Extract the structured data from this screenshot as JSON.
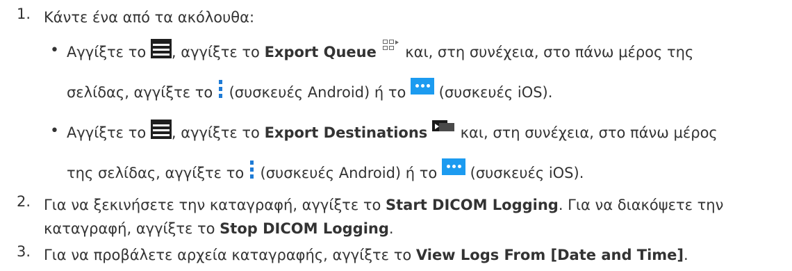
{
  "steps": [
    {
      "num": "1.",
      "text": "Κάντε ένα από τα ακόλουθα:"
    },
    {
      "num": "2.",
      "a": "Για να ξεκινήσετε την καταγραφή, αγγίξτε το ",
      "b1": "Start DICOM Logging",
      "c": ". Για να διακόψετε την καταγραφή, αγγίξτε το ",
      "b2": "Stop DICOM Logging",
      "d": "."
    },
    {
      "num": "3.",
      "a": "Για να προβάλετε αρχεία καταγραφής, αγγίξτε το ",
      "b1": "View Logs From [Date and Time]",
      "c": "."
    }
  ],
  "bullets": [
    {
      "bullet": "•",
      "l1_pre": "Αγγίξτε το ",
      "l1_mid": ", αγγίξτε το ",
      "bold": "Export Queue",
      "l1_post": " και, στη συνέχεια, στο πάνω μέρος της",
      "l2_pre": "σελίδας, αγγίξτε το ",
      "l2_android": " (συσκευές Android) ή το ",
      "l2_ios": " (συσκευές iOS)."
    },
    {
      "bullet": "•",
      "l1_pre": "Αγγίξτε το ",
      "l1_mid": ", αγγίξτε το ",
      "bold": "Export Destinations",
      "l1_post": " και, στη συνέχεια, στο πάνω μέρος",
      "l2_pre": "της σελίδας, αγγίξτε το ",
      "l2_android": " (συσκευές Android) ή το ",
      "l2_ios": " (συσκευές iOS)."
    }
  ],
  "icons": {
    "menu": "hamburger-menu-icon",
    "export_queue": "export-queue-icon",
    "export_destinations": "export-destinations-icon",
    "android_more": "vertical-dots-icon",
    "ios_more": "horizontal-dots-icon"
  },
  "colors": {
    "text": "#333333",
    "ios_accent": "#1c9bf0",
    "android_accent": "#1e7bd6"
  }
}
